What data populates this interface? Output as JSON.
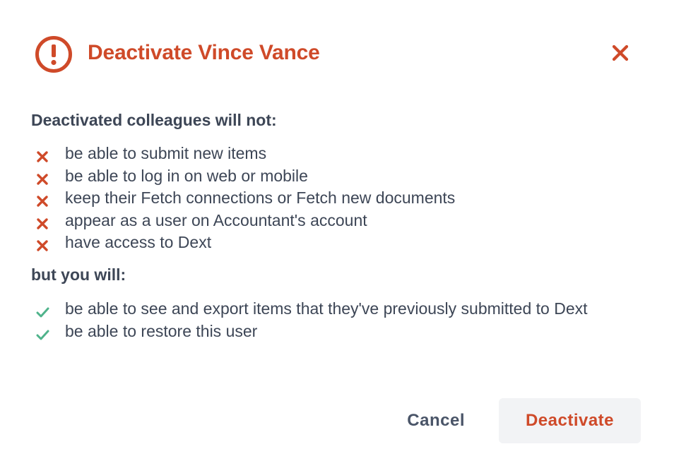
{
  "dialog": {
    "title": "Deactivate Vince Vance",
    "icons": {
      "title_icon": "exclamation-circle-icon",
      "close_icon": "close-icon",
      "negative_icon": "x-icon",
      "positive_icon": "check-icon"
    },
    "colors": {
      "accent": "#cf4a29",
      "text": "#3d4656",
      "success": "#4fb38b",
      "button_bg": "#f2f3f5"
    }
  },
  "will_not": {
    "heading": "Deactivated colleagues will not:",
    "items": [
      "be able to submit new items",
      "be able to log in on web or mobile",
      "keep their Fetch connections or Fetch new documents",
      "appear as a user on Accountant's account",
      "have access to Dext"
    ]
  },
  "will": {
    "heading": "but you will:",
    "items": [
      "be able to see and export items that they've previously submitted to Dext",
      "be able to restore this user"
    ]
  },
  "footer": {
    "cancel_label": "Cancel",
    "deactivate_label": "Deactivate"
  }
}
